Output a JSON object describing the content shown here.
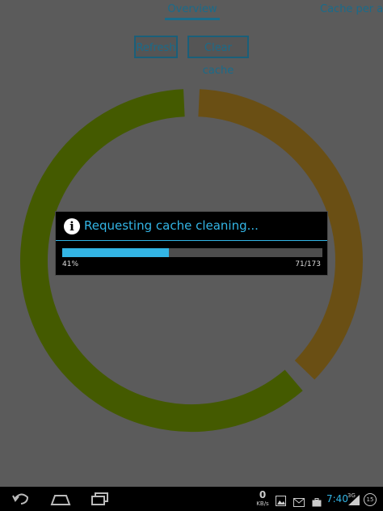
{
  "tabs": {
    "overview": "Overview",
    "cache_per_app": "Cache per a"
  },
  "buttons": {
    "refresh": "Refresh",
    "clear_cache": "Clear cache"
  },
  "dialog": {
    "title": "Requesting cache cleaning...",
    "progress_percent_label": "41%",
    "progress_count_label": "71/173",
    "progress_value": 71,
    "progress_max": 173
  },
  "donut": {
    "segments": [
      {
        "color": "#6a4f14",
        "fraction": 0.38
      },
      {
        "color": "#445a00",
        "fraction": 0.62
      }
    ]
  },
  "status_bar": {
    "net_speed": "0",
    "net_unit": "KB/s",
    "time": "7:40",
    "network": "3G",
    "battery": "15"
  },
  "colors": {
    "accent": "#33b5e5",
    "background": "#5b5b5b"
  }
}
